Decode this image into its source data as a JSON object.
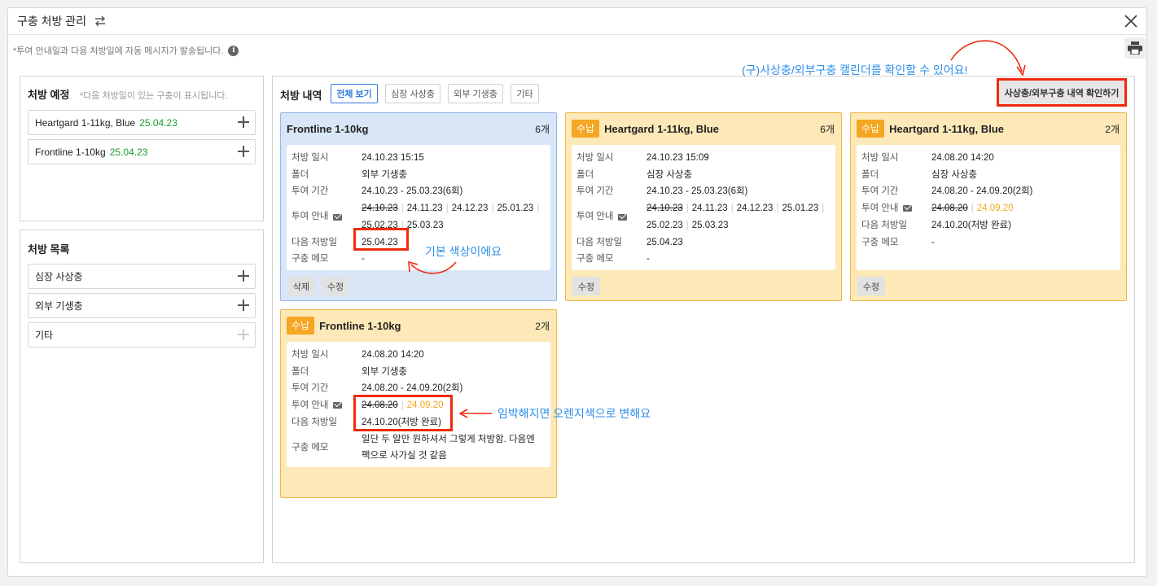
{
  "header": {
    "title": "구충 처방 관리"
  },
  "notice": "*투여 안내일과 다음 처방일에 자동 메시지가 발송됩니다.",
  "scheduled": {
    "title": "처방 예정",
    "hint": "*다음 처방일이 있는 구충이 표시됩니다.",
    "items": [
      {
        "name": "Heartgard 1-11kg, Blue",
        "date": "25.04.23"
      },
      {
        "name": "Frontline 1-10kg",
        "date": "25.04.23"
      }
    ]
  },
  "catalog": {
    "title": "처방 목록",
    "items": [
      {
        "name": "심장 사상충"
      },
      {
        "name": "외부 기생충"
      },
      {
        "name": "기타"
      }
    ]
  },
  "history": {
    "title": "처방 내역",
    "tabs": [
      "전체 보기",
      "심장 사상충",
      "외부 기생충",
      "기타"
    ],
    "active_tab": "전체 보기",
    "view_button": "사상충/외부구충 내역 확인하기"
  },
  "labels": {
    "date": "처방 일시",
    "folder": "폴더",
    "period": "투여 기간",
    "guide": "투여 안내",
    "next": "다음 처방일",
    "memo": "구충 메모",
    "delete": "삭제",
    "edit": "수정",
    "paid": "수납"
  },
  "cards": [
    {
      "title": "Frontline 1-10kg",
      "count": "6개",
      "paid": false,
      "color": "blue",
      "date": "24.10.23 15:15",
      "folder": "외부 기생충",
      "period": "24.10.23 - 25.03.23(6회)",
      "guide_done": "24.10.23",
      "guide_rest": [
        "24.11.23",
        "24.12.23",
        "25.01.23",
        "25.02.23",
        "25.03.23"
      ],
      "next": "25.04.23",
      "memo": "-"
    },
    {
      "title": "Heartgard 1-11kg, Blue",
      "count": "6개",
      "paid": true,
      "color": "orange",
      "date": "24.10.23 15:09",
      "folder": "심장 사상충",
      "period": "24.10.23 - 25.03.23(6회)",
      "guide_done": "24.10.23",
      "guide_rest": [
        "24.11.23",
        "24.12.23",
        "25.01.23",
        "25.02.23",
        "25.03.23"
      ],
      "next": "25.04.23",
      "memo": "-"
    },
    {
      "title": "Heartgard 1-11kg, Blue",
      "count": "2개",
      "paid": true,
      "color": "orange",
      "date": "24.08.20 14:20",
      "folder": "심장 사상충",
      "period": "24.08.20 - 24.09.20(2회)",
      "guide_done": "24.08.20",
      "guide_rest": [
        "24.09.20"
      ],
      "next": "24.10.20(처방 완료)",
      "memo": "-"
    },
    {
      "title": "Frontline 1-10kg",
      "count": "2개",
      "paid": true,
      "color": "orange",
      "date": "24.08.20 14:20",
      "folder": "외부 기생충",
      "period": "24.08.20 - 24.09.20(2회)",
      "guide_done": "24.08.20",
      "guide_rest": [
        "24.09.20"
      ],
      "next": "24.10.20(처방 완료)",
      "memo": "일단 두 알만 원하셔서 그렇게 처방함. 다음엔 팩으로 사가실 것 같음"
    }
  ],
  "annotations": {
    "calendar": "(구)사상충/외부구충 캘린더를 확인할 수 있어요!",
    "default_color": "기본 색상이에요",
    "orange_change": "임박해지면 오렌지색으로 변해요"
  },
  "colors": {
    "green": "#19a02e",
    "orange": "#f5a623",
    "annotation": "#2e8fe8",
    "highlight": "#f02a10"
  }
}
